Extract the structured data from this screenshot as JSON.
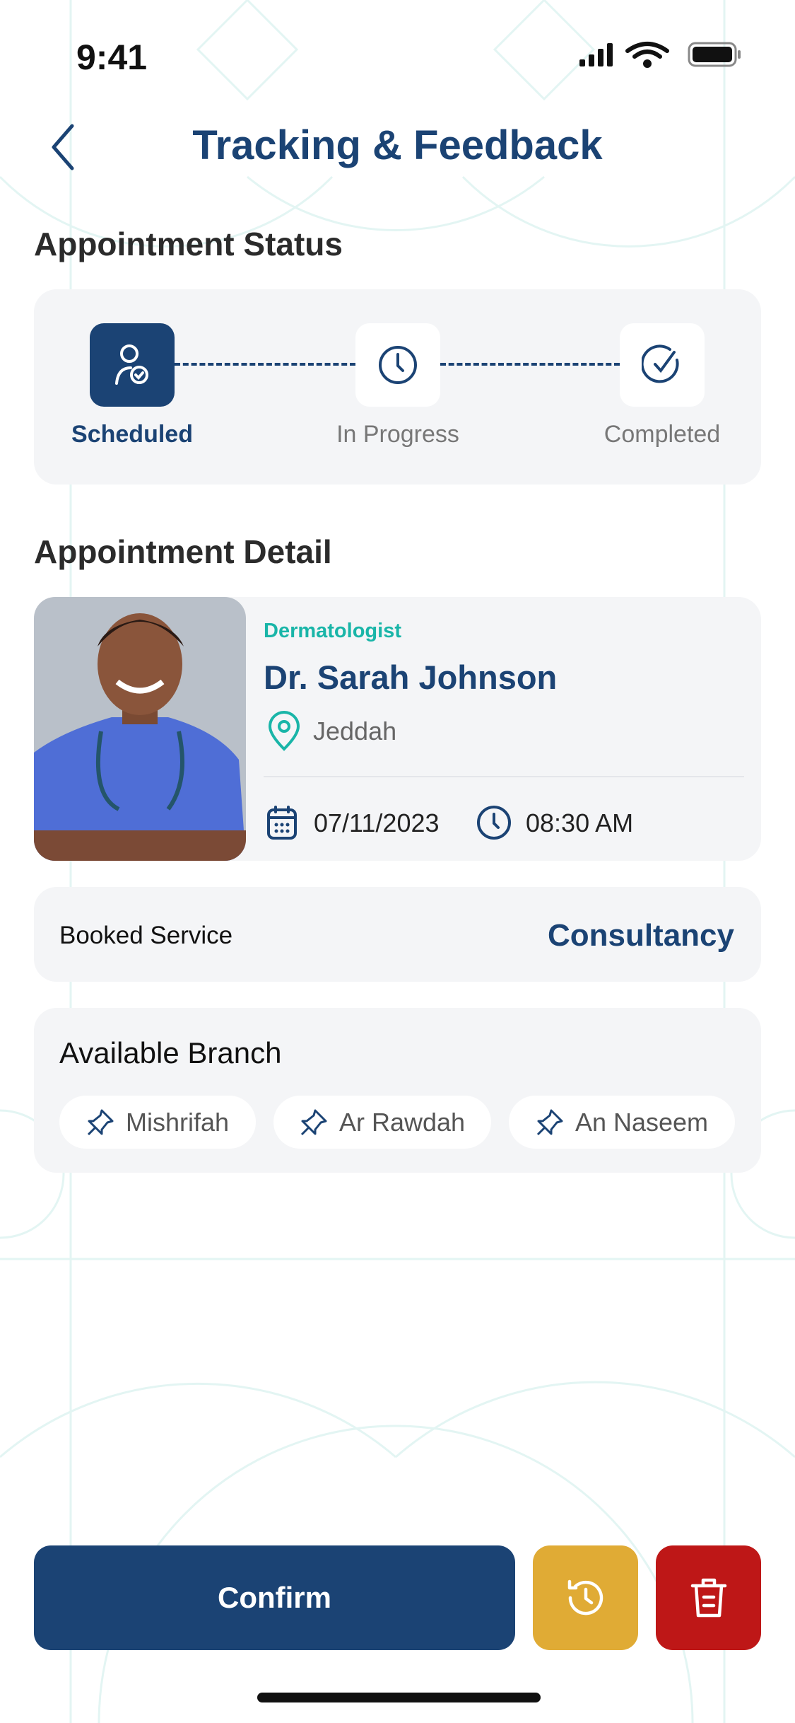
{
  "status_bar": {
    "time": "9:41"
  },
  "header": {
    "title": "Tracking & Feedback"
  },
  "status_section": {
    "heading": "Appointment Status",
    "steps": [
      {
        "label": "Scheduled",
        "state": "active"
      },
      {
        "label": "In Progress",
        "state": "pending"
      },
      {
        "label": "Completed",
        "state": "pending"
      }
    ]
  },
  "detail_section": {
    "heading": "Appointment Detail",
    "doctor": {
      "specialty": "Dermatologist",
      "name": "Dr. Sarah Johnson",
      "location": "Jeddah",
      "date": "07/11/2023",
      "time": "08:30 AM"
    }
  },
  "booked_service": {
    "label": "Booked Service",
    "value": "Consultancy"
  },
  "branches": {
    "heading": "Available Branch",
    "items": [
      "Mishrifah",
      "Ar Rawdah",
      "An Naseem"
    ]
  },
  "actions": {
    "confirm_label": "Confirm"
  },
  "colors": {
    "primary": "#1b4374",
    "accent": "#19b5a8",
    "reschedule": "#e0ab35",
    "delete": "#be1717",
    "card": "#f4f5f7"
  }
}
